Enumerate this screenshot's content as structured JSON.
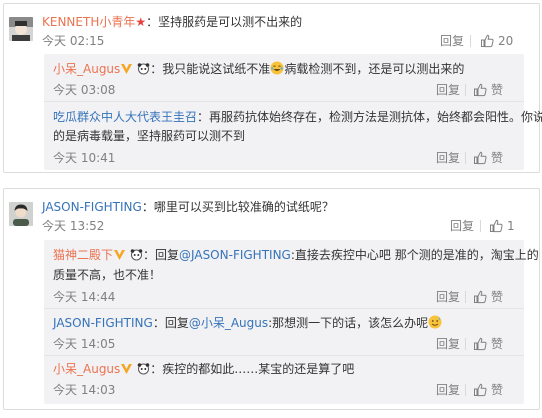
{
  "thread1": {
    "main": {
      "username": "KENNETH小青年",
      "suffix_symbol": "★",
      "text": "：坚持服药是可以测不出来的",
      "time": "今天 02:15",
      "reply_label": "回复",
      "like_count": "20"
    },
    "replies": [
      {
        "username": "小呆_Augus",
        "text_before_emoji": "：我只能说这试纸不准",
        "text_after_emoji": "病载检测不到，还是可以测出来的",
        "time": "今天 03:08",
        "reply_label": "回复",
        "like_label": "赞"
      },
      {
        "username": "吃瓜群众中人大代表王圭召",
        "line1": "：再服药抗体始终存在，检测方法是测抗体，始终都会阳性。你说",
        "line2": "的是病毒载量，坚持服药可以测不到",
        "time": "今天 10:41",
        "reply_label": "回复",
        "like_label": "赞"
      }
    ]
  },
  "thread2": {
    "main": {
      "username": "JASON-FIGHTING",
      "text": "：哪里可以买到比较准确的试纸呢？",
      "time": "今天 13:52",
      "reply_label": "回复",
      "like_count": "1"
    },
    "replies": [
      {
        "username": "猫神二殿下",
        "mention_prefix": "：回复",
        "mention": "@JASON-FIGHTING",
        "line1_rest": ":直接去疾控中心吧  那个测的是准的，淘宝上的",
        "line2": "质量不高，也不准！",
        "time": "今天 14:44",
        "reply_label": "回复",
        "like_label": "赞"
      },
      {
        "username": "JASON-FIGHTING",
        "mention_prefix": "：回复",
        "mention": "@小呆_Augus",
        "text": ":那想测一下的话，该怎么办呢",
        "time": "今天 14:05",
        "reply_label": "回复",
        "like_label": "赞"
      },
      {
        "username": "小呆_Augus",
        "text": "：疾控的都如此……某宝的还是算了吧",
        "time": "今天 14:03",
        "reply_label": "回复",
        "like_label": "赞"
      }
    ]
  },
  "colors": {
    "username": "#eb7350",
    "link_blue": "#3573b9",
    "text": "#333333",
    "meta": "#808080",
    "sub_bg": "#f2f2f5",
    "vip_badge": "#f5a623",
    "star": "#e8403a"
  },
  "icons": [
    "thumb-up-icon",
    "vip-badge-icon",
    "panda-icon",
    "laugh-cry-emoji-icon",
    "sweat-smile-emoji-icon",
    "avatar-icon"
  ]
}
